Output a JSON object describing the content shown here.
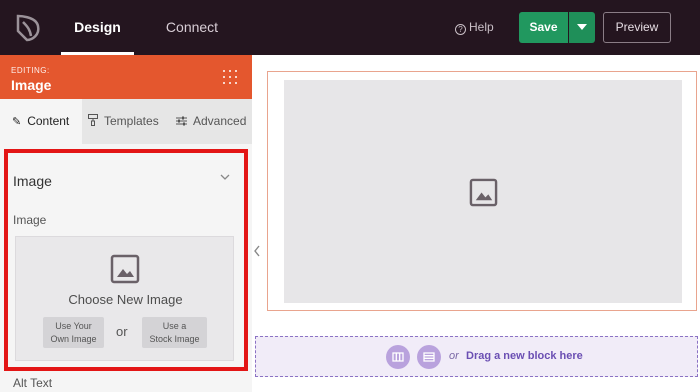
{
  "topbar": {
    "tabs": [
      {
        "label": "Design",
        "active": true
      },
      {
        "label": "Connect",
        "active": false
      }
    ],
    "help_label": "Help",
    "save_label": "Save",
    "preview_label": "Preview"
  },
  "sidebar": {
    "editing_label": "EDITING:",
    "editing_title": "Image",
    "subtabs": [
      {
        "label": "Content",
        "icon": "pencil-icon",
        "active": true
      },
      {
        "label": "Templates",
        "icon": "paint-roller-icon",
        "active": false
      },
      {
        "label": "Advanced",
        "icon": "sliders-icon",
        "active": false
      }
    ],
    "section_title": "Image",
    "field_label": "Image",
    "uploader": {
      "title": "Choose New Image",
      "own_line1": "Use Your",
      "own_line2": "Own Image",
      "or": "or",
      "stock_line1": "Use a",
      "stock_line2": "Stock Image"
    },
    "alt_text_label": "Alt Text"
  },
  "canvas": {
    "dropzone_or": "or",
    "dropzone_text": "Drag a new block here"
  },
  "colors": {
    "topbar": "#24151f",
    "accent_orange": "#e4572e",
    "save_green": "#21985f",
    "highlight_red": "#e31616",
    "dropzone_purple": "#6b4fb3"
  }
}
